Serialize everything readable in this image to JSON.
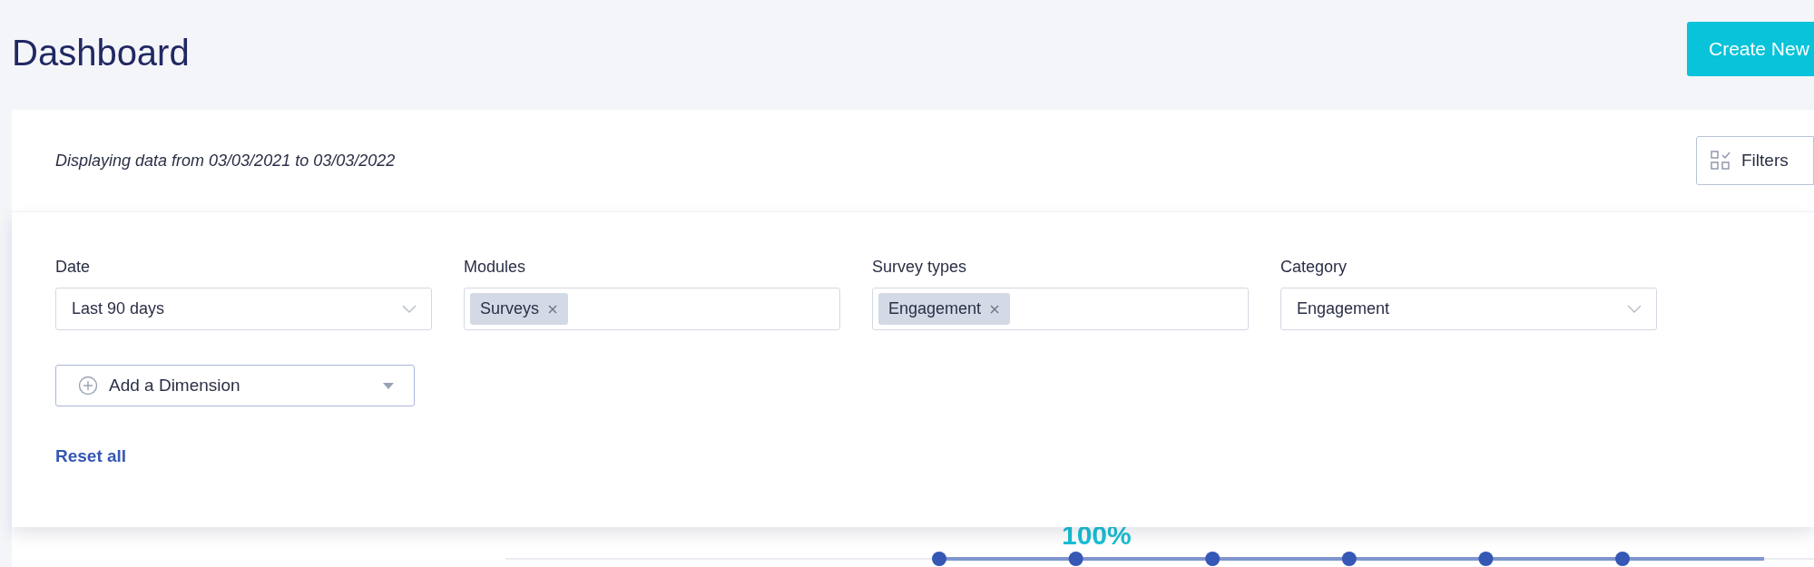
{
  "page": {
    "title": "Dashboard",
    "create_button": "Create New"
  },
  "card": {
    "range_text": "Displaying data from 03/03/2021 to 03/03/2022",
    "filters_button": "Filters"
  },
  "filters": [
    {
      "label": "Date",
      "kind": "select",
      "value": "Last 90 days"
    },
    {
      "label": "Modules",
      "kind": "tags",
      "tags": [
        "Surveys"
      ]
    },
    {
      "label": "Survey types",
      "kind": "tags",
      "tags": [
        "Engagement"
      ]
    },
    {
      "label": "Category",
      "kind": "select",
      "value": "Engagement"
    }
  ],
  "add_dimension": "Add a Dimension",
  "reset": "Reset all",
  "chart_label": "100%"
}
